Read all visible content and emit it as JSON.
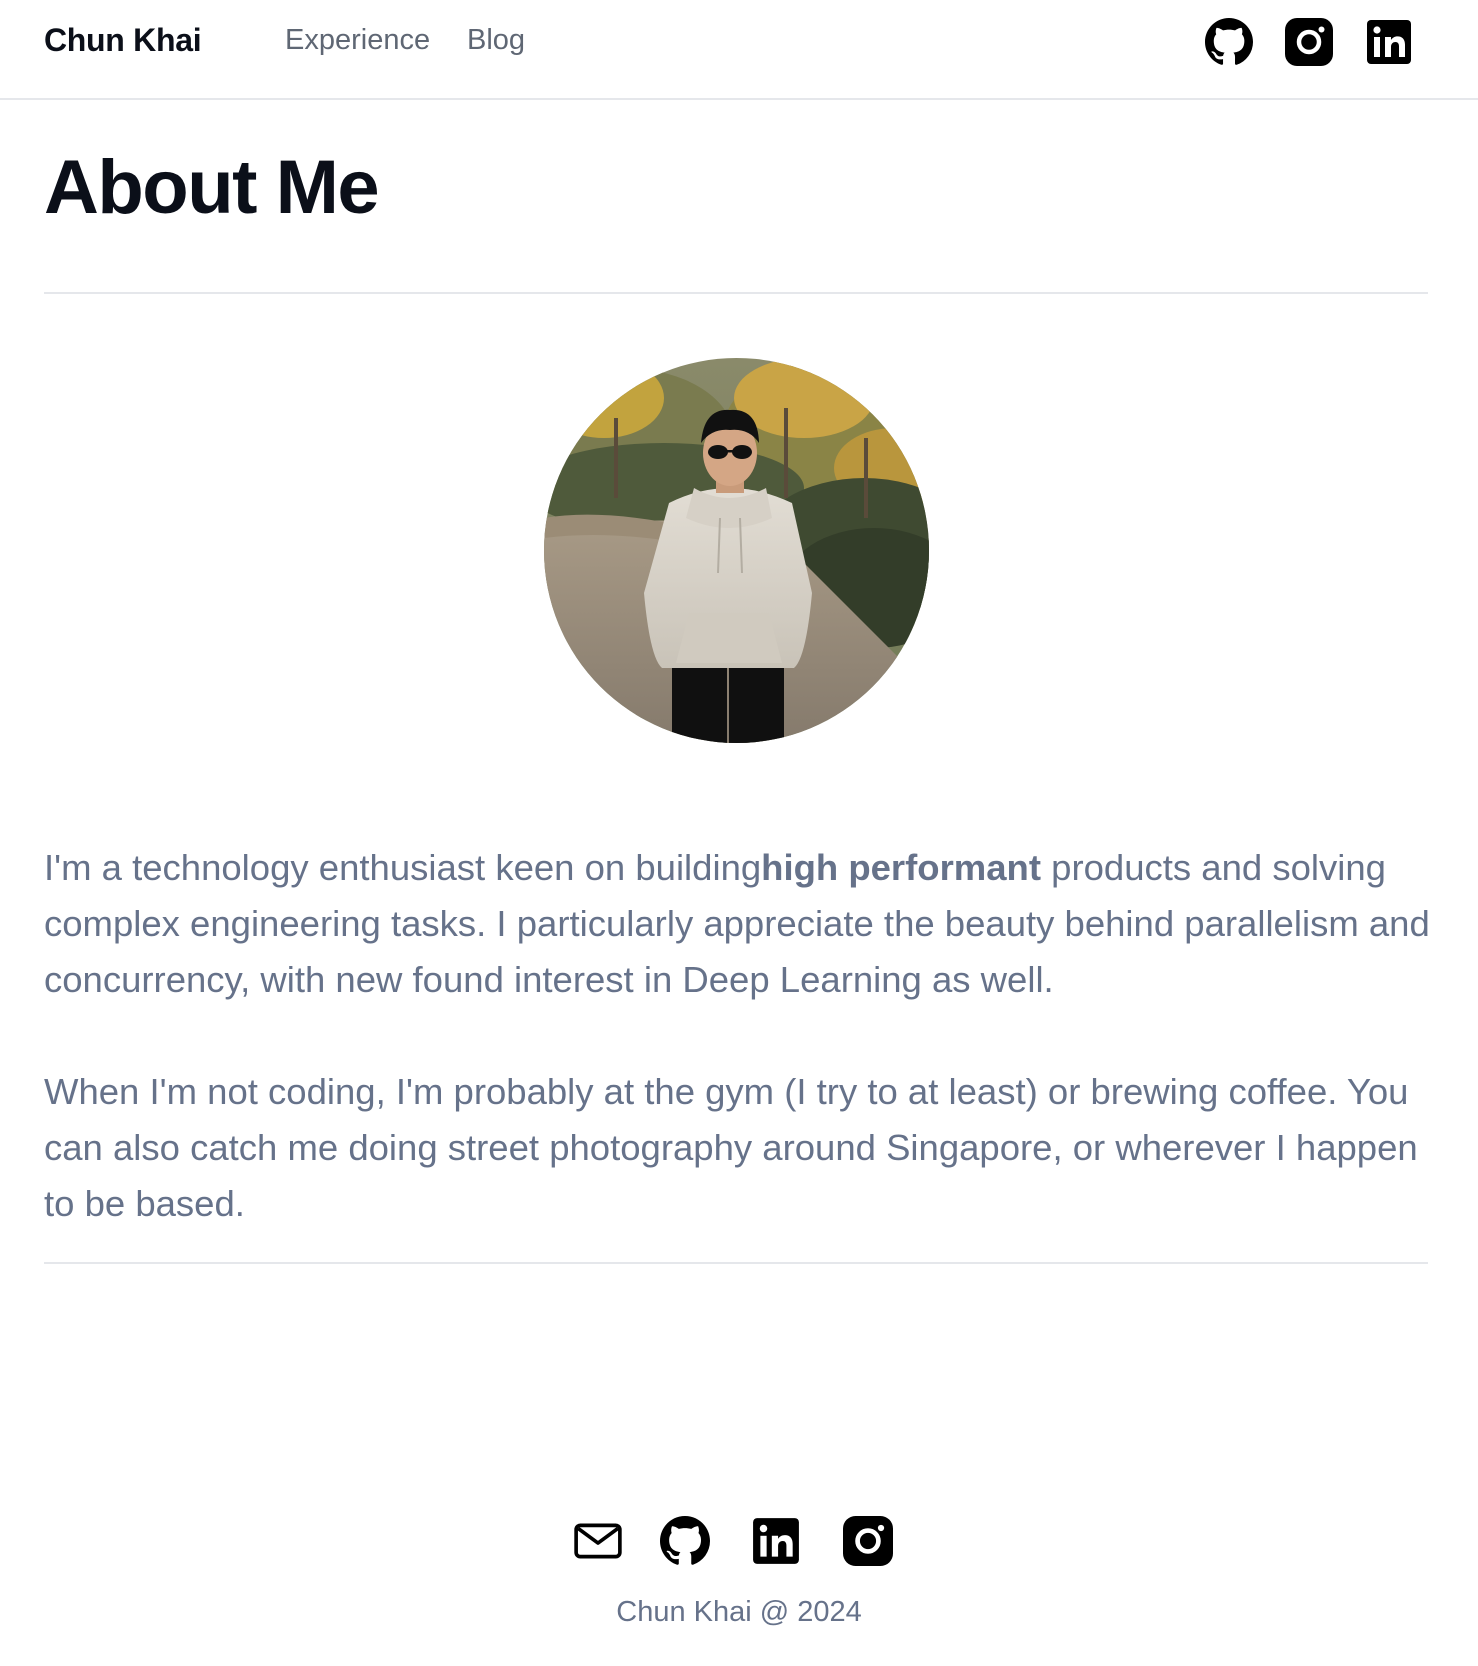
{
  "nav": {
    "brand": "Chun Khai",
    "links": [
      "Experience",
      "Blog"
    ],
    "social_icons": [
      "github-icon",
      "instagram-icon",
      "linkedin-icon"
    ]
  },
  "main": {
    "title": "About Me",
    "bio": {
      "p1_before": "I'm a technology enthusiast keen on building",
      "p1_bold": "high performant",
      "p1_after": " products and solving complex engineering tasks. I particularly appreciate the beauty behind parallelism and concurrency, with new found interest in Deep Learning as well.",
      "p2": "When I'm not coding, I'm probably at the gym (I try to at least) or brewing coffee. You can also catch me doing street photography around Singapore, or wherever I happen to be based."
    }
  },
  "footer": {
    "icons": [
      "mail-icon",
      "github-icon",
      "linkedin-icon",
      "instagram-icon"
    ],
    "copyright": "Chun Khai @ 2024"
  },
  "colors": {
    "heading": "#0b0f19",
    "nav_link": "#5f6774",
    "body_text": "#66728a",
    "divider": "#e5e7eb",
    "icon": "#000000",
    "background": "#ffffff"
  }
}
